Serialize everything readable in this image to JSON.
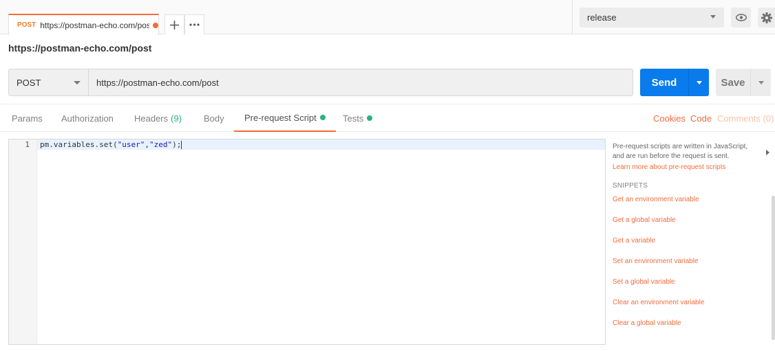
{
  "tab": {
    "method": "POST",
    "url": "https://postman-echo.com/pos"
  },
  "tab_actions": {
    "add_icon": "plus-icon",
    "more_icon": "more-icon"
  },
  "environment": {
    "selected": "release"
  },
  "request": {
    "title": "https://postman-echo.com/post",
    "method": "POST",
    "url": "https://postman-echo.com/post"
  },
  "buttons": {
    "send": "Send",
    "save": "Save"
  },
  "request_tabs": {
    "params": "Params",
    "authorization": "Authorization",
    "headers": "Headers",
    "headers_count": "(9)",
    "body": "Body",
    "prerequest": "Pre-request Script",
    "tests": "Tests"
  },
  "links": {
    "cookies": "Cookies",
    "code": "Code",
    "comments": "Comments (0)"
  },
  "editor": {
    "line_number": "1",
    "code_prefix": "pm.variables.set(",
    "arg1": "\"user\"",
    "comma": ",",
    "arg2": "\"zed\"",
    "code_suffix": ");"
  },
  "sidebar": {
    "description": "Pre-request scripts are written in JavaScript, and are run before the request is sent.",
    "learn_more": "Learn more about pre-request scripts",
    "snippets_heading": "SNIPPETS",
    "snippets": [
      "Get an environment variable",
      "Get a global variable",
      "Get a variable",
      "Set an environment variable",
      "Set a global variable",
      "Clear an environment variable",
      "Clear a global variable"
    ]
  },
  "colors": {
    "accent": "#f26b3a",
    "send": "#097bed",
    "status_green": "#26b47f"
  }
}
